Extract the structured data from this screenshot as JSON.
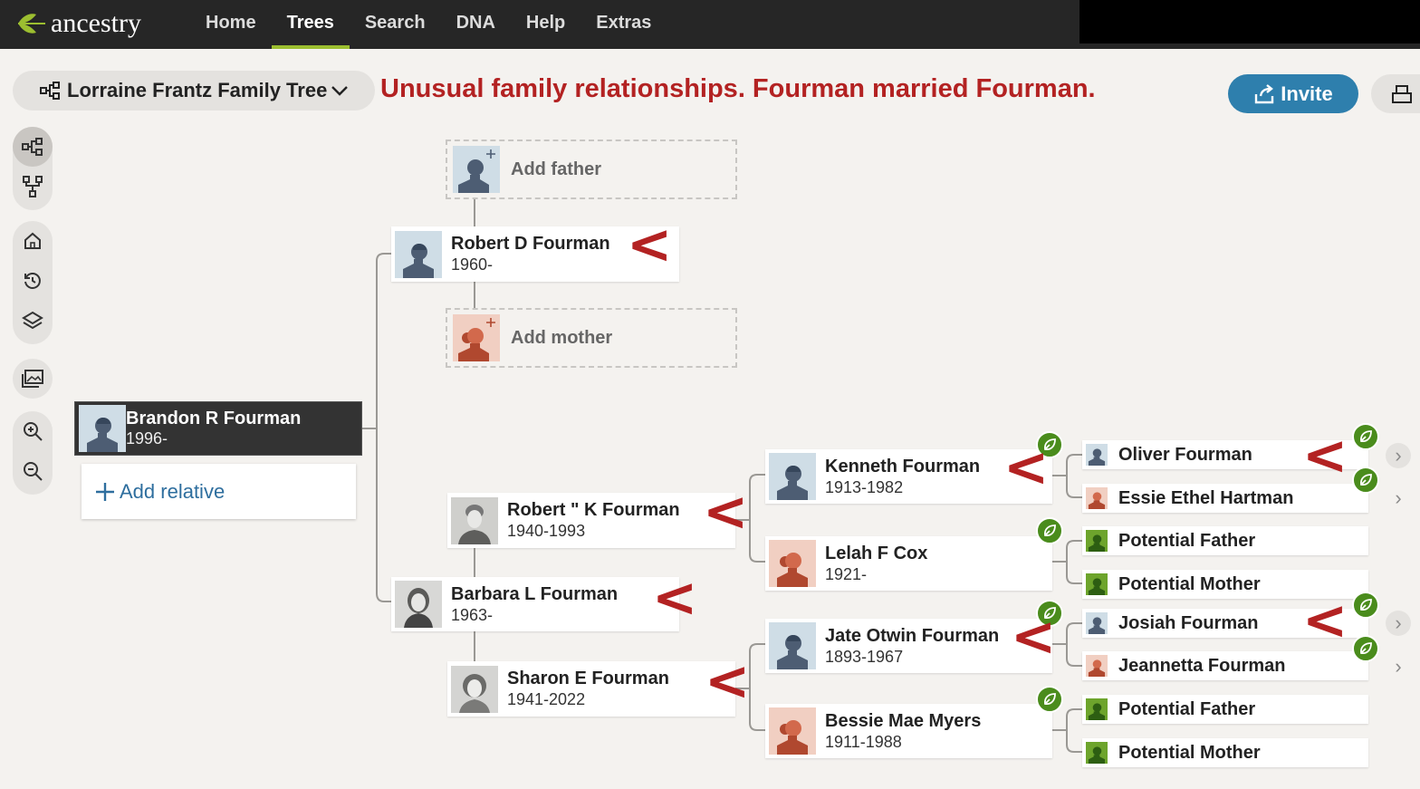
{
  "brand": {
    "name": "ancestry"
  },
  "nav": {
    "home": "Home",
    "trees": "Trees",
    "search": "Search",
    "dna": "DNA",
    "help": "Help",
    "extras": "Extras"
  },
  "tree_select": {
    "label": "Lorraine Frantz Family Tree"
  },
  "annotation": "Unusual family relationships. Fourman married Fourman.",
  "invite": {
    "label": "Invite"
  },
  "focus_person": {
    "name": "Brandon R Fourman",
    "dates": "1996-"
  },
  "add_relative": {
    "label": "Add relative"
  },
  "empty_slots": {
    "father": "Add father",
    "mother": "Add mother"
  },
  "people": {
    "robert_d": {
      "name": "Robert D Fourman",
      "dates": "1960-"
    },
    "barbara": {
      "name": "Barbara L Fourman",
      "dates": "1963-"
    },
    "robert_k": {
      "name": "Robert \" K Fourman",
      "dates": "1940-1993"
    },
    "sharon": {
      "name": "Sharon E Fourman",
      "dates": "1941-2022"
    },
    "kenneth": {
      "name": "Kenneth Fourman",
      "dates": "1913-1982"
    },
    "lelah": {
      "name": "Lelah F Cox",
      "dates": "1921-"
    },
    "jate": {
      "name": "Jate Otwin Fourman",
      "dates": "1893-1967"
    },
    "bessie": {
      "name": "Bessie Mae Myers",
      "dates": "1911-1988"
    },
    "oliver": {
      "name": "Oliver Fourman"
    },
    "essie": {
      "name": "Essie Ethel Hartman"
    },
    "pf1": {
      "name": "Potential Father"
    },
    "pm1": {
      "name": "Potential Mother"
    },
    "josiah": {
      "name": "Josiah Fourman"
    },
    "jeannetta": {
      "name": "Jeannetta Fourman"
    },
    "pf2": {
      "name": "Potential Father"
    },
    "pm2": {
      "name": "Potential Mother"
    }
  },
  "marker": "<",
  "chevron": "›",
  "colors": {
    "topbar": "#262626",
    "accent_green": "#9cbe30",
    "invite_blue": "#2e7fad",
    "annotation_red": "#b32222",
    "hint_green": "#4a8c1c"
  }
}
